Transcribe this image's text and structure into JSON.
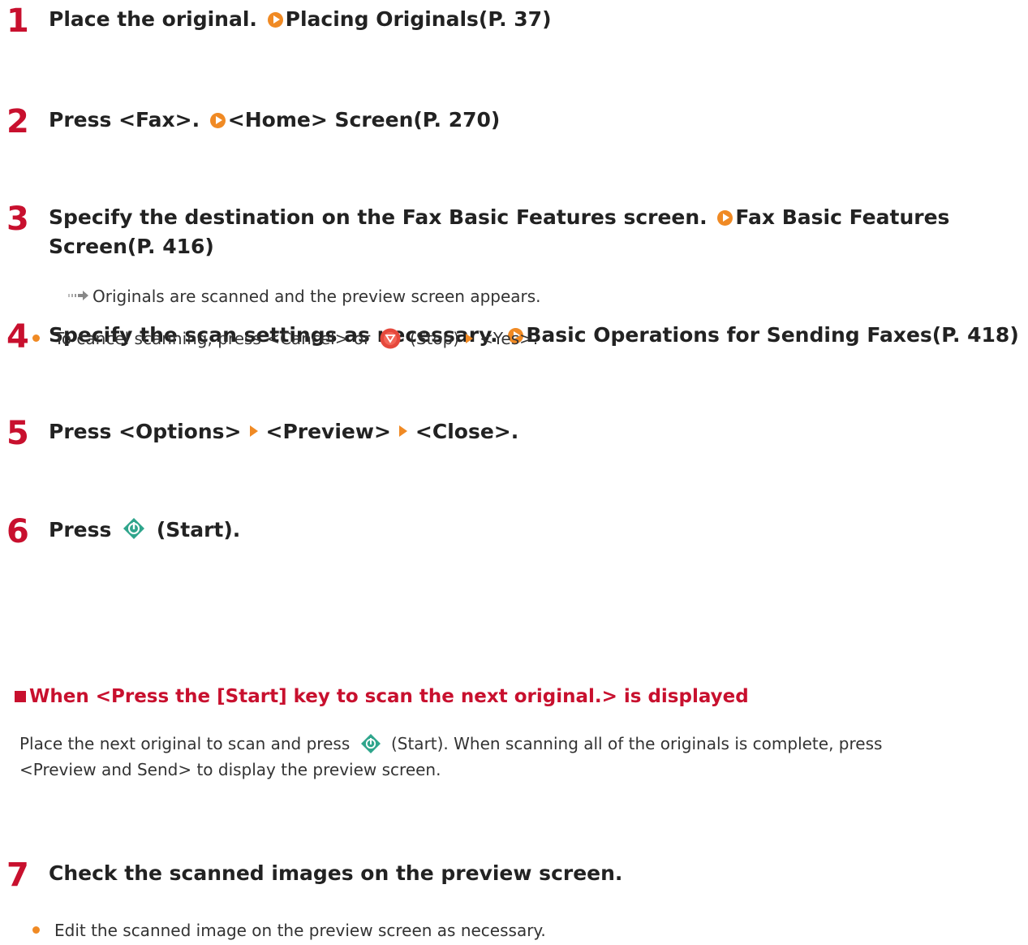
{
  "steps": [
    {
      "num": "1",
      "text": "Place the original.",
      "link": "Placing Originals(P. 37)"
    },
    {
      "num": "2",
      "text": "Press <Fax>.",
      "link": "<Home> Screen(P. 270)"
    },
    {
      "num": "3",
      "text": "Specify the destination on the Fax Basic Features screen.",
      "link": "Fax Basic Features Screen(P. 416)"
    },
    {
      "num": "4",
      "text": "Specify the scan settings as necessary.",
      "link": "Basic Operations for Sending Faxes(P. 418)"
    },
    {
      "num": "5",
      "parts": [
        "Press <Options>",
        "<Preview>",
        "<Close>."
      ]
    },
    {
      "num": "6",
      "pre": "Press",
      "post": "(Start)."
    },
    {
      "num": "7",
      "text": "Check the scanned images on the preview screen."
    }
  ],
  "step6": {
    "result": "Originals are scanned and the preview screen appears.",
    "bullet_pre": "To cancel scanning, press <Cancel> or",
    "bullet_mid": "(Stop)",
    "bullet_post": "<Yes>."
  },
  "subsection": {
    "heading": "When <Press the [Start] key to scan the next original.> is displayed",
    "line1_pre": "Place the next original to scan and press",
    "line1_post": "(Start). When scanning all of the originals is complete, press",
    "line2": "<Preview and Send> to display the preview screen."
  },
  "step7": {
    "bullet": "Edit the scanned image on the preview screen as necessary."
  },
  "colors": {
    "accent": "#c8102e",
    "link_arrow": "#f08a24",
    "start_key": "#2fa58c",
    "stop_key": "#e5483c"
  }
}
